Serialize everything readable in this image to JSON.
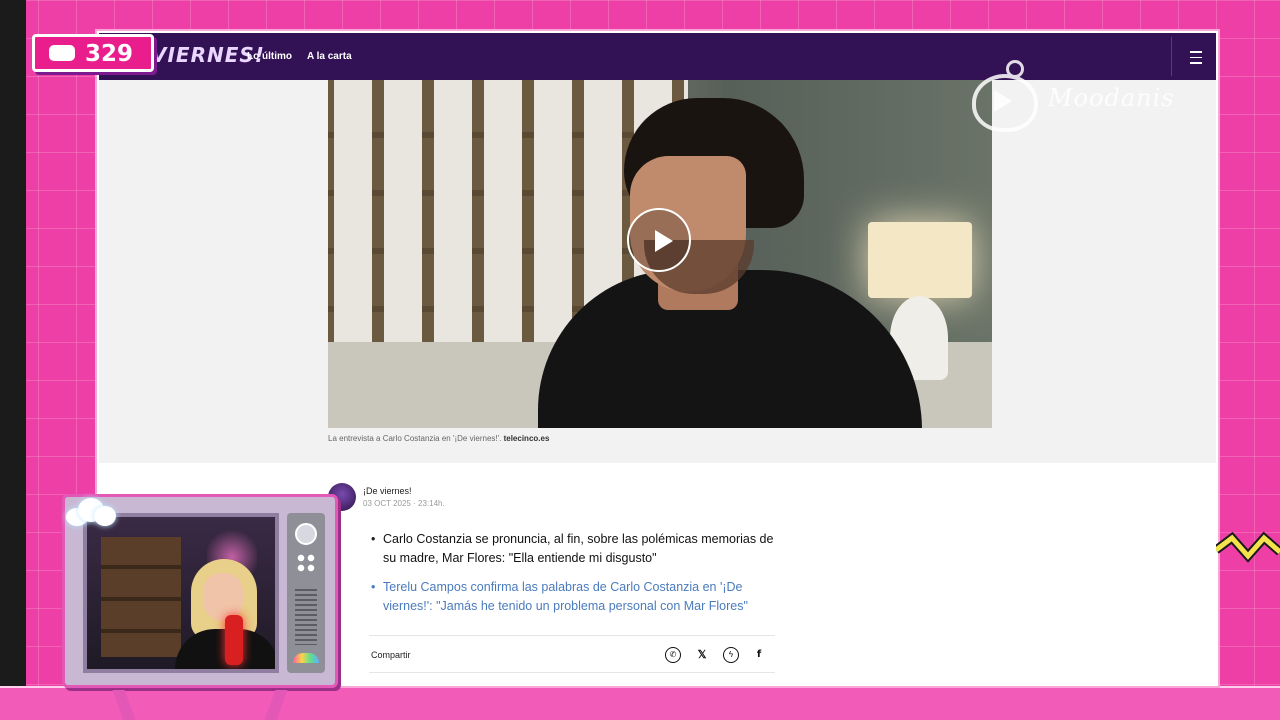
{
  "stream_overlay": {
    "viewer_count": "329",
    "viewer_icon": "chat-bubble-icon",
    "watermark_icon": "heart-tv-play-icon",
    "watermark_text": "Moodanis",
    "colors": {
      "background": "#ee3fa6",
      "badge": "#e91e8c",
      "tv_frame": "#e357b6"
    }
  },
  "site": {
    "logo_text": "VIERNES!",
    "nav": [
      {
        "label": "Lo último"
      },
      {
        "label": "A la carta"
      }
    ],
    "menu_icon": "hamburger-menu-icon",
    "header_color": "#331155"
  },
  "article": {
    "video_play_icon": "play-icon",
    "caption_text": "La entrevista a Carlo Costanzia en '¡De viernes!'.",
    "caption_source": "telecinco.es",
    "author_name": "¡De viernes!",
    "author_date": "03 OCT 2025 · 23:14h.",
    "related": [
      {
        "text": "Carlo Costanzia se pronuncia, al fin, sobre las polémicas memorias de su madre, Mar Flores: \"Ella entiende mi disgusto\"",
        "style": "plain"
      },
      {
        "text": "Terelu Campos confirma las palabras de Carlo Costanzia en '¡De viernes!': \"Jamás he tenido un problema personal con Mar Flores\"",
        "style": "link",
        "color": "#4a7bbd"
      }
    ],
    "share": {
      "label": "Compartir",
      "buttons": [
        {
          "icon": "whatsapp-icon",
          "glyph": "✆"
        },
        {
          "icon": "x-icon",
          "glyph": "𝕏"
        },
        {
          "icon": "messenger-icon",
          "glyph": "ϟ"
        },
        {
          "icon": "facebook-icon",
          "glyph": "f"
        }
      ]
    }
  }
}
